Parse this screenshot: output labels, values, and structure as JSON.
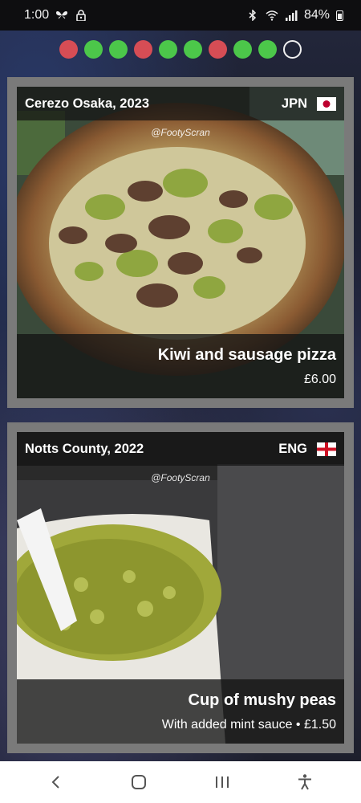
{
  "status_bar": {
    "time": "1:00",
    "battery": "84%"
  },
  "progress": {
    "dots": [
      "red",
      "green",
      "green",
      "red",
      "green",
      "green",
      "red",
      "green",
      "green",
      "empty"
    ]
  },
  "cards": [
    {
      "club": "Cerezo Osaka, 2023",
      "country": "JPN",
      "watermark": "@FootyScran",
      "dish": "Kiwi and sausage pizza",
      "price": "£6.00"
    },
    {
      "club": "Notts County, 2022",
      "country": "ENG",
      "watermark": "@FootyScran",
      "dish": "Cup of mushy peas",
      "price": "With added mint sauce • £1.50"
    }
  ],
  "colors": {
    "red": "#d64d55",
    "green": "#4cc74a",
    "card_frame": "#7a7a7a"
  },
  "icons": {
    "nav": [
      "back-icon",
      "home-icon",
      "recents-icon",
      "accessibility-icon"
    ]
  }
}
